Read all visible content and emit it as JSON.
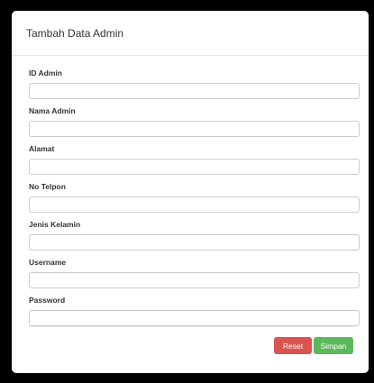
{
  "modal": {
    "title": "Tambah Data Admin"
  },
  "form": {
    "fields": [
      {
        "label": "ID Admin",
        "value": "",
        "placeholder": ""
      },
      {
        "label": "Nama Admin",
        "value": "",
        "placeholder": ""
      },
      {
        "label": "Alamat",
        "value": "",
        "placeholder": ""
      },
      {
        "label": "No Telpon",
        "value": "",
        "placeholder": ""
      },
      {
        "label": "Jenis Kelamin",
        "value": "",
        "placeholder": ""
      },
      {
        "label": "Username",
        "value": "",
        "placeholder": ""
      },
      {
        "label": "Password",
        "value": "",
        "placeholder": ""
      }
    ]
  },
  "footer": {
    "reset_label": "Reset",
    "simpan_label": "Simpan"
  },
  "colors": {
    "reset": "#d9534f",
    "simpan": "#5cb85c",
    "backdrop": "#000000"
  }
}
